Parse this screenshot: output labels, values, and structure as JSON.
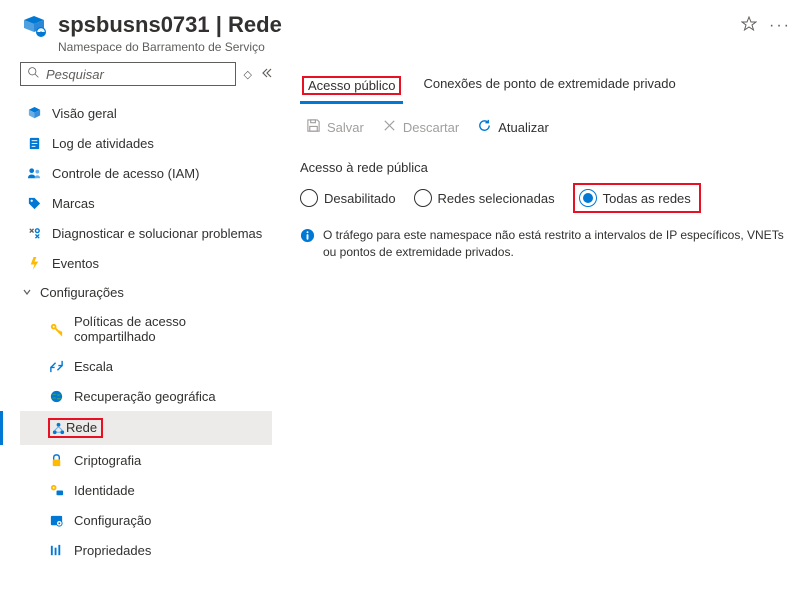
{
  "header": {
    "title": "spsbusns0731 | Rede",
    "subtitle": "Namespace do Barramento de Serviço"
  },
  "search": {
    "placeholder": "Pesquisar"
  },
  "nav": {
    "overview": "Visão geral",
    "activity_log": "Log de atividades",
    "iam": "Controle de acesso (IAM)",
    "tags": "Marcas",
    "diagnose": "Diagnosticar e solucionar problemas",
    "events": "Eventos",
    "settings_group": "Configurações",
    "shared_access": "Políticas de acesso compartilhado",
    "scale": "Escala",
    "geo": "Recuperação geográfica",
    "network": "Rede",
    "encryption": "Criptografia",
    "identity": "Identidade",
    "configuration": "Configuração",
    "properties": "Propriedades"
  },
  "tabs": {
    "public": "Acesso público",
    "private": "Conexões de ponto de extremidade privado"
  },
  "toolbar": {
    "save": "Salvar",
    "discard": "Descartar",
    "refresh": "Atualizar"
  },
  "section": {
    "label": "Acesso à rede pública",
    "opt_disabled": "Desabilitado",
    "opt_selected_networks": "Redes selecionadas",
    "opt_all_networks": "Todas as redes",
    "info": "O tráfego para este namespace não está restrito a intervalos de IP específicos, VNETs ou pontos de extremidade privados."
  }
}
